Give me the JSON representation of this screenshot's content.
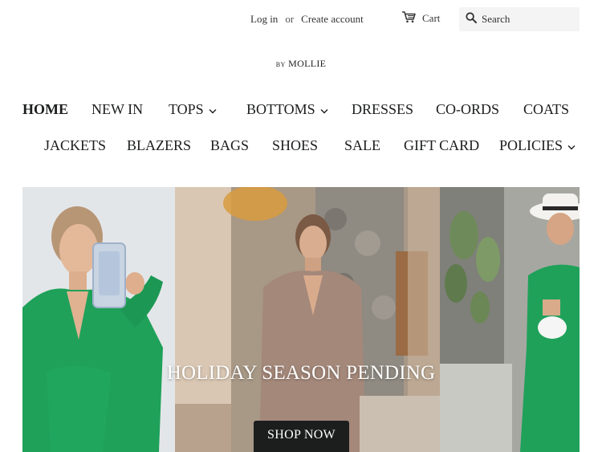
{
  "header": {
    "login_label": "Log in",
    "or_text": "or",
    "create_account_label": "Create account",
    "cart_label": "Cart",
    "search_placeholder": "Search"
  },
  "logo": {
    "by": "BY",
    "name": "MOLLIE"
  },
  "nav": {
    "row1": [
      {
        "label": "HOME",
        "active": true,
        "dropdown": false
      },
      {
        "label": "NEW IN",
        "dropdown": false
      },
      {
        "label": "TOPS",
        "dropdown": true
      },
      {
        "label": "BOTTOMS",
        "dropdown": true
      },
      {
        "label": "DRESSES",
        "dropdown": false
      },
      {
        "label": "CO-ORDS",
        "dropdown": false
      },
      {
        "label": "COATS",
        "dropdown": false
      }
    ],
    "row2": [
      {
        "label": "JACKETS",
        "dropdown": false
      },
      {
        "label": "BLAZERS",
        "dropdown": false
      },
      {
        "label": "BAGS",
        "dropdown": false
      },
      {
        "label": "SHOES",
        "dropdown": false
      },
      {
        "label": "SALE",
        "dropdown": false
      },
      {
        "label": "GIFT CARD",
        "dropdown": false
      },
      {
        "label": "POLICIES",
        "dropdown": true
      }
    ]
  },
  "hero": {
    "title": "HOLIDAY SEASON PENDING",
    "button_label": "SHOP NOW"
  },
  "icons": {
    "cart": "cart-icon",
    "search": "search-icon",
    "dropdown": "chevron-down-icon"
  },
  "colors": {
    "text": "#1c1d1d",
    "button_bg": "#1c1d1d",
    "search_bg": "#f4f4f4",
    "outfit_green": "#1fa15a"
  }
}
